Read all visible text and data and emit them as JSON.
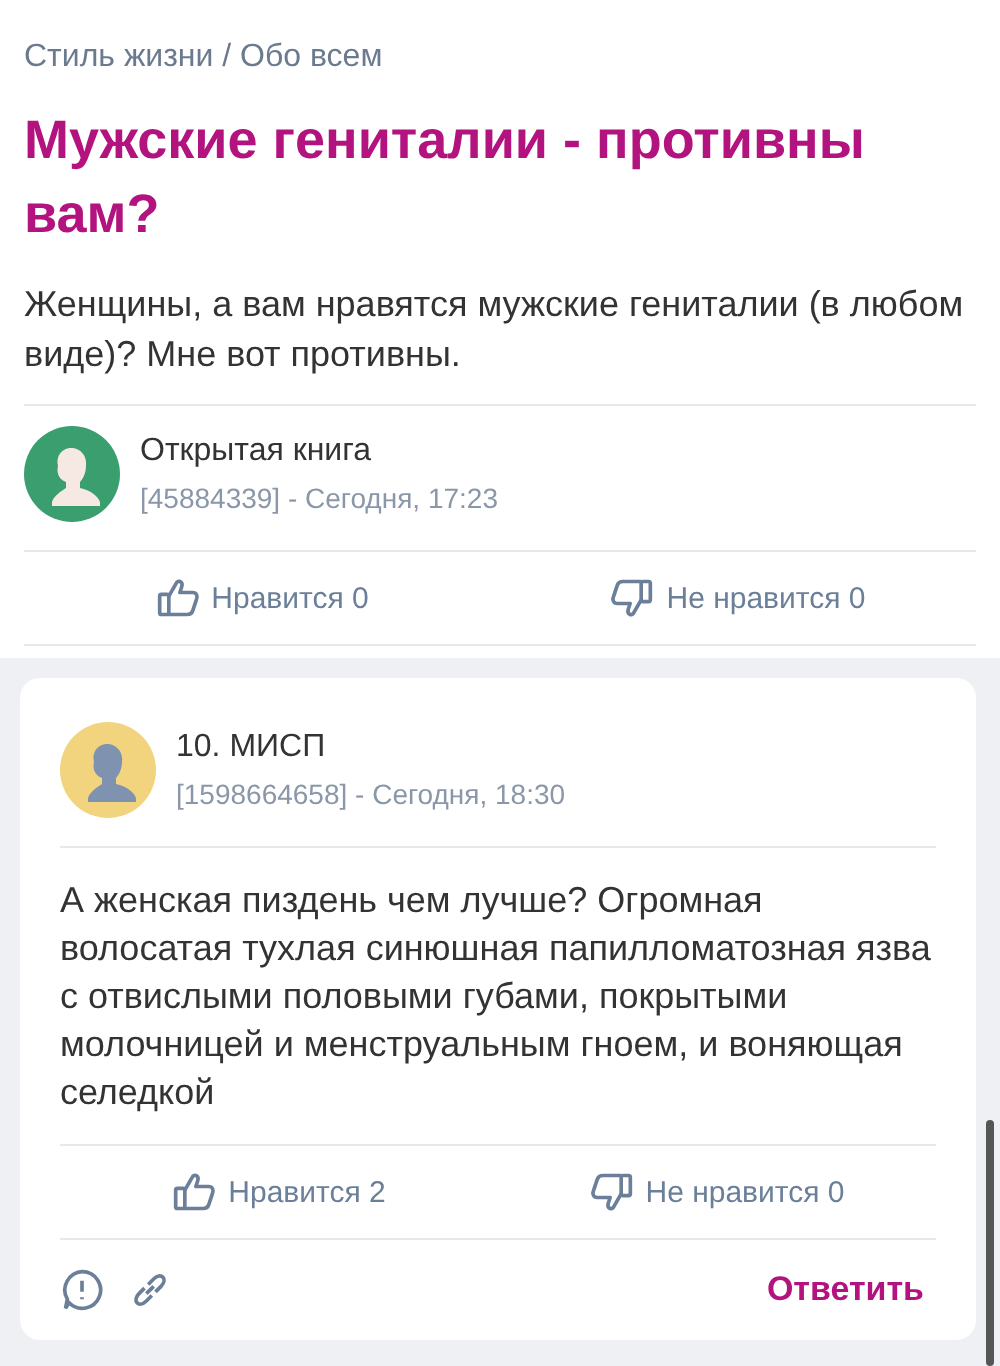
{
  "breadcrumb": "Стиль жизни / Обо всем",
  "title": "Мужские гениталии - противны вам?",
  "body": "Женщины, а вам нравятся мужские гениталии (в любом виде)? Мне вот противны.",
  "author": {
    "name": "Открытая книга",
    "meta": "[45884339] - Сегодня, 17:23",
    "color": "#3a9e6e"
  },
  "reactions": {
    "like": "Нравится 0",
    "dislike": "Не нравится 0"
  },
  "comment": {
    "name": "10. МИСП",
    "meta": "[1598664658] - Сегодня, 18:30",
    "color": "#f2d47f",
    "text": "А женская пиздень чем лучше? Огромная волосатая тухлая синюшная папилломатозная язва с отвислыми половыми губами, покрытыми молочницей и менструальным гноем, и воняющая селедкой",
    "like": "Нравится 2",
    "dislike": "Не нравится 0",
    "reply": "Ответить"
  }
}
